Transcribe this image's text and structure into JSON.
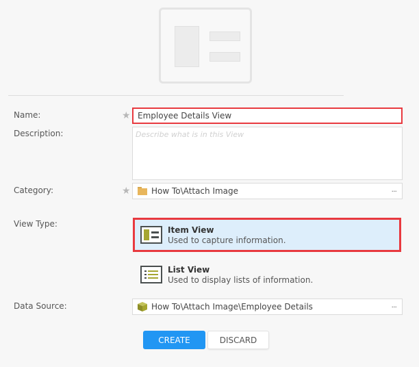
{
  "preview": {
    "icon": "item-view-preview-icon"
  },
  "form": {
    "name": {
      "label": "Name:",
      "value": "Employee Details View",
      "required": true
    },
    "description": {
      "label": "Description:",
      "placeholder": "Describe what is in this View",
      "value": ""
    },
    "category": {
      "label": "Category:",
      "value": "How To\\Attach Image",
      "icon": "folder-icon",
      "required": true,
      "browse_label": "···"
    },
    "view_type": {
      "label": "View Type:",
      "options": [
        {
          "title": "Item View",
          "description": "Used to capture information.",
          "icon": "item-view-icon",
          "selected": true
        },
        {
          "title": "List View",
          "description": "Used to display lists of information.",
          "icon": "list-view-icon",
          "selected": false
        }
      ]
    },
    "data_source": {
      "label": "Data Source:",
      "value": "How To\\Attach Image\\Employee Details",
      "icon": "smartobject-cube-icon",
      "browse_label": "···"
    }
  },
  "buttons": {
    "create": "CREATE",
    "discard": "DISCARD"
  },
  "colors": {
    "accent": "#2196f3",
    "highlight": "#e8393f",
    "selected_bg": "#ddeefb",
    "icon_olive": "#a6a630"
  }
}
